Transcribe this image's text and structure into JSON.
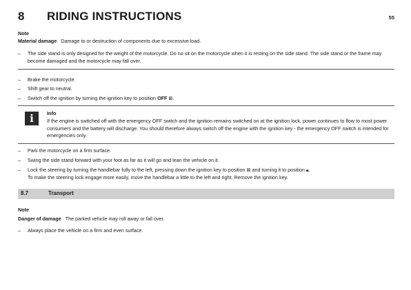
{
  "header": {
    "chapter_number": "8",
    "chapter_title": "RIDING INSTRUCTIONS",
    "page_number": "55"
  },
  "note1": {
    "heading": "Note",
    "label": "Material damage",
    "text": "Damage to or destruction of components due to excessive load.",
    "bullet": "The side stand is only designed for the weight of the motorcycle. Do no sit on the motorcycle when it is resting on the side stand. The side stand or the frame may become damaged and the motorcycle may fall over."
  },
  "steps1": [
    "Brake the motorcycle.",
    "Shift gear to neutral."
  ],
  "step_ignition": {
    "before": "Switch off the ignition by turning the ignition key to position ",
    "bold": "OFF",
    "symbol": "⊠",
    "after": "."
  },
  "info": {
    "title": "Info",
    "text": "If the engine is switched off with the emergency OFF switch and the ignition remains switched on at the ignition lock, power continues to flow to most power consumers and the battery will discharge. You should therefore always switch off the engine with the ignition key - the emergency OFF switch is intended for emergencies only."
  },
  "steps2": [
    "Park the motorcycle on a firm surface.",
    "Swing the side stand forward with your foot as far as it will go and lean the vehicle on it."
  ],
  "step_lock": {
    "part1": "Lock the steering by turning the handlebar fully to the left, pressing down the ignition key to position ",
    "symbol1": "⊠",
    "part2": " and turning it to position ",
    "symbol2": "🔒︎",
    "part3": ".",
    "part4": "To make the steering lock engage more easily, move the handlebar a little to the left and right. Remove the ignition key."
  },
  "section": {
    "number": "8.7",
    "title": "Transport"
  },
  "note2": {
    "heading": "Note",
    "label": "Danger of damage",
    "text": "The parked vehicle may roll away or fall over.",
    "bullet": "Always place the vehicle on a firm and even surface."
  },
  "icons": {
    "info": "info-icon"
  }
}
